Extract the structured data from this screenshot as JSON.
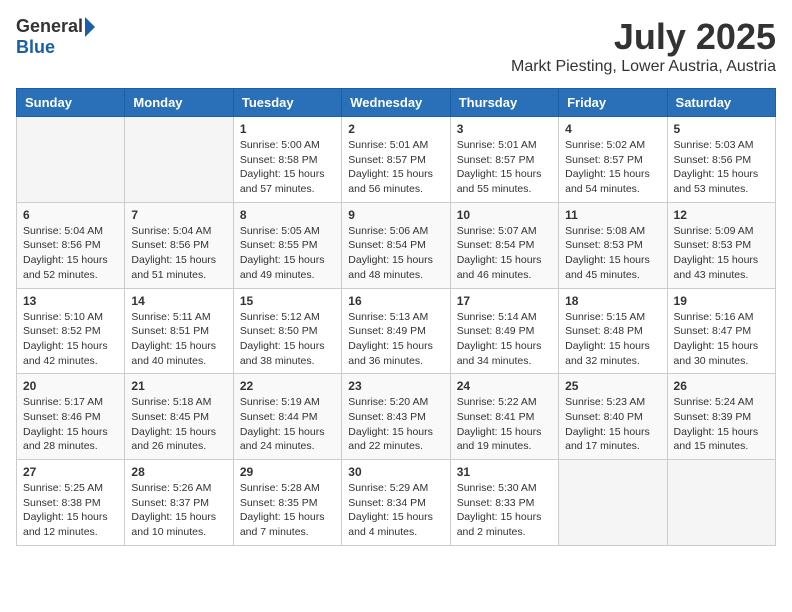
{
  "header": {
    "logo": {
      "general": "General",
      "blue": "Blue"
    },
    "title": "July 2025",
    "location": "Markt Piesting, Lower Austria, Austria"
  },
  "calendar": {
    "days_of_week": [
      "Sunday",
      "Monday",
      "Tuesday",
      "Wednesday",
      "Thursday",
      "Friday",
      "Saturday"
    ],
    "weeks": [
      [
        {
          "day": "",
          "empty": true
        },
        {
          "day": "",
          "empty": true
        },
        {
          "day": "1",
          "sunrise": "Sunrise: 5:00 AM",
          "sunset": "Sunset: 8:58 PM",
          "daylight": "Daylight: 15 hours and 57 minutes."
        },
        {
          "day": "2",
          "sunrise": "Sunrise: 5:01 AM",
          "sunset": "Sunset: 8:57 PM",
          "daylight": "Daylight: 15 hours and 56 minutes."
        },
        {
          "day": "3",
          "sunrise": "Sunrise: 5:01 AM",
          "sunset": "Sunset: 8:57 PM",
          "daylight": "Daylight: 15 hours and 55 minutes."
        },
        {
          "day": "4",
          "sunrise": "Sunrise: 5:02 AM",
          "sunset": "Sunset: 8:57 PM",
          "daylight": "Daylight: 15 hours and 54 minutes."
        },
        {
          "day": "5",
          "sunrise": "Sunrise: 5:03 AM",
          "sunset": "Sunset: 8:56 PM",
          "daylight": "Daylight: 15 hours and 53 minutes."
        }
      ],
      [
        {
          "day": "6",
          "sunrise": "Sunrise: 5:04 AM",
          "sunset": "Sunset: 8:56 PM",
          "daylight": "Daylight: 15 hours and 52 minutes."
        },
        {
          "day": "7",
          "sunrise": "Sunrise: 5:04 AM",
          "sunset": "Sunset: 8:56 PM",
          "daylight": "Daylight: 15 hours and 51 minutes."
        },
        {
          "day": "8",
          "sunrise": "Sunrise: 5:05 AM",
          "sunset": "Sunset: 8:55 PM",
          "daylight": "Daylight: 15 hours and 49 minutes."
        },
        {
          "day": "9",
          "sunrise": "Sunrise: 5:06 AM",
          "sunset": "Sunset: 8:54 PM",
          "daylight": "Daylight: 15 hours and 48 minutes."
        },
        {
          "day": "10",
          "sunrise": "Sunrise: 5:07 AM",
          "sunset": "Sunset: 8:54 PM",
          "daylight": "Daylight: 15 hours and 46 minutes."
        },
        {
          "day": "11",
          "sunrise": "Sunrise: 5:08 AM",
          "sunset": "Sunset: 8:53 PM",
          "daylight": "Daylight: 15 hours and 45 minutes."
        },
        {
          "day": "12",
          "sunrise": "Sunrise: 5:09 AM",
          "sunset": "Sunset: 8:53 PM",
          "daylight": "Daylight: 15 hours and 43 minutes."
        }
      ],
      [
        {
          "day": "13",
          "sunrise": "Sunrise: 5:10 AM",
          "sunset": "Sunset: 8:52 PM",
          "daylight": "Daylight: 15 hours and 42 minutes."
        },
        {
          "day": "14",
          "sunrise": "Sunrise: 5:11 AM",
          "sunset": "Sunset: 8:51 PM",
          "daylight": "Daylight: 15 hours and 40 minutes."
        },
        {
          "day": "15",
          "sunrise": "Sunrise: 5:12 AM",
          "sunset": "Sunset: 8:50 PM",
          "daylight": "Daylight: 15 hours and 38 minutes."
        },
        {
          "day": "16",
          "sunrise": "Sunrise: 5:13 AM",
          "sunset": "Sunset: 8:49 PM",
          "daylight": "Daylight: 15 hours and 36 minutes."
        },
        {
          "day": "17",
          "sunrise": "Sunrise: 5:14 AM",
          "sunset": "Sunset: 8:49 PM",
          "daylight": "Daylight: 15 hours and 34 minutes."
        },
        {
          "day": "18",
          "sunrise": "Sunrise: 5:15 AM",
          "sunset": "Sunset: 8:48 PM",
          "daylight": "Daylight: 15 hours and 32 minutes."
        },
        {
          "day": "19",
          "sunrise": "Sunrise: 5:16 AM",
          "sunset": "Sunset: 8:47 PM",
          "daylight": "Daylight: 15 hours and 30 minutes."
        }
      ],
      [
        {
          "day": "20",
          "sunrise": "Sunrise: 5:17 AM",
          "sunset": "Sunset: 8:46 PM",
          "daylight": "Daylight: 15 hours and 28 minutes."
        },
        {
          "day": "21",
          "sunrise": "Sunrise: 5:18 AM",
          "sunset": "Sunset: 8:45 PM",
          "daylight": "Daylight: 15 hours and 26 minutes."
        },
        {
          "day": "22",
          "sunrise": "Sunrise: 5:19 AM",
          "sunset": "Sunset: 8:44 PM",
          "daylight": "Daylight: 15 hours and 24 minutes."
        },
        {
          "day": "23",
          "sunrise": "Sunrise: 5:20 AM",
          "sunset": "Sunset: 8:43 PM",
          "daylight": "Daylight: 15 hours and 22 minutes."
        },
        {
          "day": "24",
          "sunrise": "Sunrise: 5:22 AM",
          "sunset": "Sunset: 8:41 PM",
          "daylight": "Daylight: 15 hours and 19 minutes."
        },
        {
          "day": "25",
          "sunrise": "Sunrise: 5:23 AM",
          "sunset": "Sunset: 8:40 PM",
          "daylight": "Daylight: 15 hours and 17 minutes."
        },
        {
          "day": "26",
          "sunrise": "Sunrise: 5:24 AM",
          "sunset": "Sunset: 8:39 PM",
          "daylight": "Daylight: 15 hours and 15 minutes."
        }
      ],
      [
        {
          "day": "27",
          "sunrise": "Sunrise: 5:25 AM",
          "sunset": "Sunset: 8:38 PM",
          "daylight": "Daylight: 15 hours and 12 minutes."
        },
        {
          "day": "28",
          "sunrise": "Sunrise: 5:26 AM",
          "sunset": "Sunset: 8:37 PM",
          "daylight": "Daylight: 15 hours and 10 minutes."
        },
        {
          "day": "29",
          "sunrise": "Sunrise: 5:28 AM",
          "sunset": "Sunset: 8:35 PM",
          "daylight": "Daylight: 15 hours and 7 minutes."
        },
        {
          "day": "30",
          "sunrise": "Sunrise: 5:29 AM",
          "sunset": "Sunset: 8:34 PM",
          "daylight": "Daylight: 15 hours and 4 minutes."
        },
        {
          "day": "31",
          "sunrise": "Sunrise: 5:30 AM",
          "sunset": "Sunset: 8:33 PM",
          "daylight": "Daylight: 15 hours and 2 minutes."
        },
        {
          "day": "",
          "empty": true
        },
        {
          "day": "",
          "empty": true
        }
      ]
    ]
  }
}
